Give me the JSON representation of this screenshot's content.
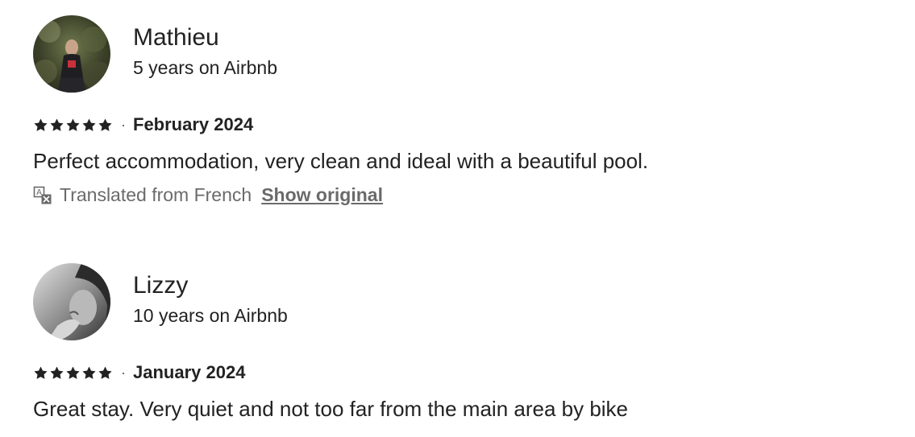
{
  "reviews": [
    {
      "reviewer_name": "Mathieu",
      "tenure": "5 years on Airbnb",
      "rating": 5,
      "date": "February 2024",
      "text": "Perfect accommodation, very clean and ideal with a beautiful pool.",
      "translation_note": "Translated from French",
      "show_original_label": "Show original"
    },
    {
      "reviewer_name": "Lizzy",
      "tenure": "10 years on Airbnb",
      "rating": 5,
      "date": "January 2024",
      "text": "Great stay. Very quiet and not too far from the main area by bike"
    }
  ],
  "separator": "·",
  "icons": {
    "star": "star-icon",
    "translate": "translate-icon"
  },
  "colors": {
    "text": "#222222",
    "muted": "#6a6a6a"
  }
}
